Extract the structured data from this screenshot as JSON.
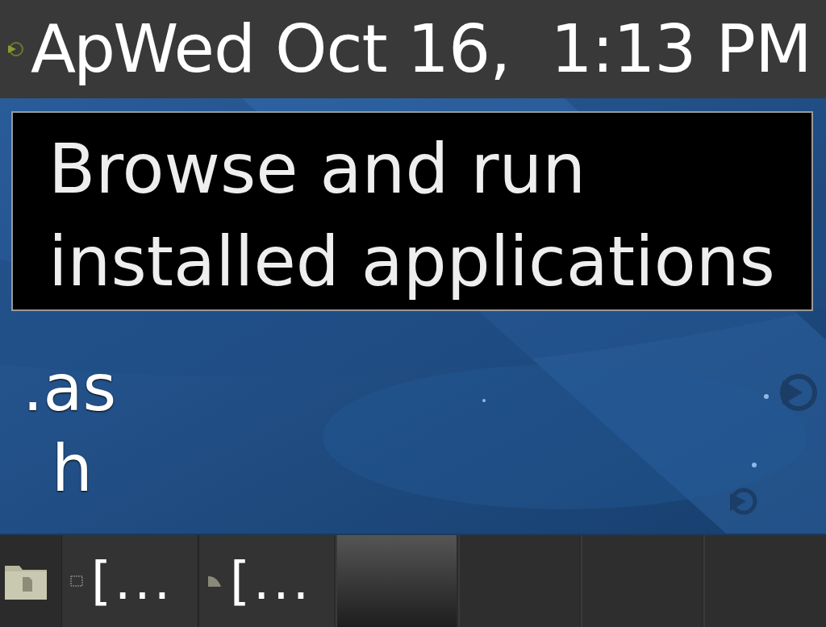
{
  "top_panel": {
    "menu_label": "Ap",
    "clock": "Wed Oct 16,  1:13 PM"
  },
  "tooltip": {
    "lines": [
      "Browse and run",
      "installed applications"
    ]
  },
  "desktop_icons": [
    {
      "label": ".as"
    },
    {
      "label": "h"
    }
  ],
  "taskbar": [
    {
      "kind": "launcher"
    },
    {
      "kind": "window",
      "label": "[...",
      "selected": false
    },
    {
      "kind": "window",
      "label": "[...",
      "selected": false
    },
    {
      "kind": "workspace",
      "selected": true
    },
    {
      "kind": "workspace",
      "selected": false
    },
    {
      "kind": "workspace",
      "selected": false
    },
    {
      "kind": "workspace",
      "selected": false
    }
  ]
}
